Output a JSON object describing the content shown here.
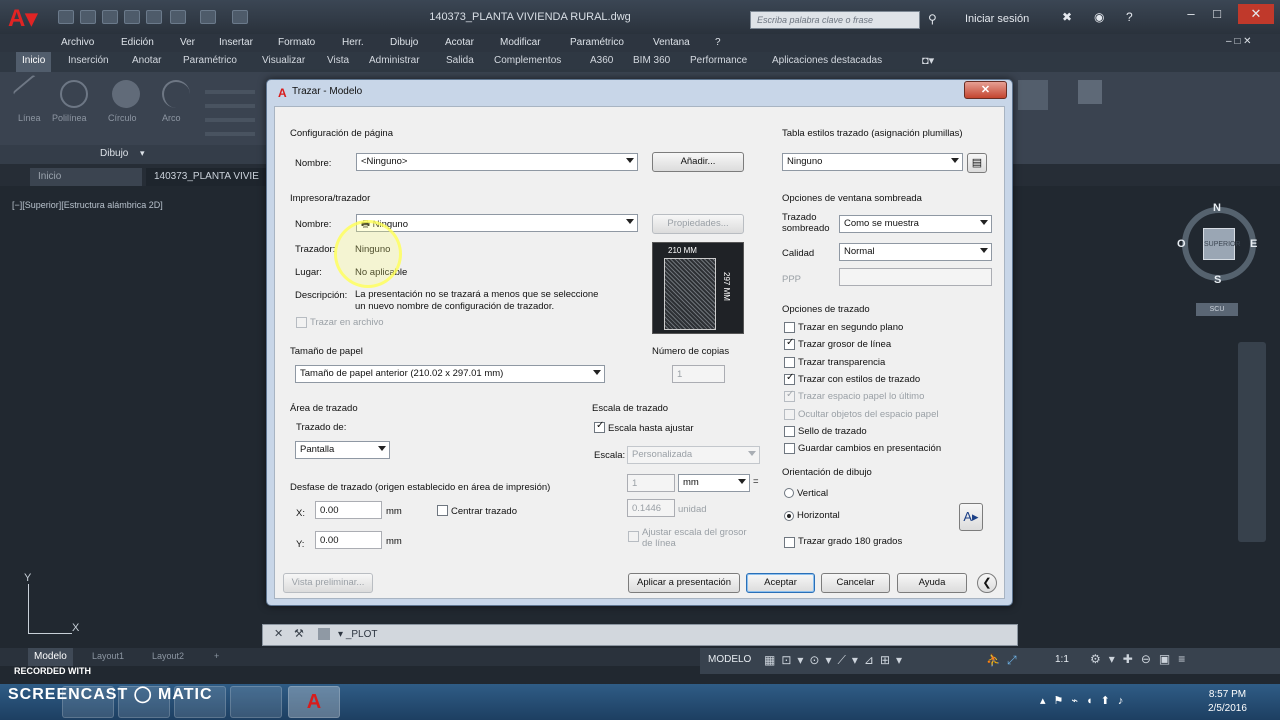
{
  "window": {
    "doc_title": "140373_PLANTA VIVIENDA RURAL.dwg",
    "search_placeholder": "Escriba palabra clave o frase",
    "login": "Iniciar sesión",
    "min": "–",
    "max": "□",
    "close": "✕"
  },
  "menu": [
    "Archivo",
    "Edición",
    "Ver",
    "Insertar",
    "Formato",
    "Herr.",
    "Dibujo",
    "Acotar",
    "Modificar",
    "Paramétrico",
    "Ventana",
    "?"
  ],
  "ribbon_tabs": [
    "Inicio",
    "Inserción",
    "Anotar",
    "Paramétrico",
    "Visualizar",
    "Vista",
    "Administrar",
    "Salida",
    "Complementos",
    "A360",
    "BIM 360",
    "Performance",
    "Aplicaciones destacadas"
  ],
  "ribbon_tools": [
    "Línea",
    "Polilínea",
    "Círculo",
    "Arco"
  ],
  "ribbon_panel": "Dibujo",
  "doc_tabs": [
    "Inicio",
    "140373_PLANTA VIVIE"
  ],
  "viewport_label": "[−][Superior][Estructura alámbrica 2D]",
  "viewcube": {
    "n": "N",
    "s": "S",
    "e": "E",
    "o": "O",
    "face": "SUPERIOR",
    "wcs": "SCU"
  },
  "ucs": {
    "x": "X",
    "y": "Y"
  },
  "command": "_PLOT",
  "layout_tabs": [
    "Modelo",
    "Layout1",
    "Layout2",
    "+"
  ],
  "status": {
    "mode": "MODELO",
    "scale": "1:1"
  },
  "watermark": {
    "line1": "RECORDED WITH",
    "line2": "SCREENCAST",
    "line3": "MATIC"
  },
  "clock": {
    "time": "8:57 PM",
    "date": "2/5/2016"
  },
  "dialog": {
    "title": "Trazar - Modelo",
    "close": "✕",
    "page_setup": {
      "heading": "Configuración de página",
      "name_label": "Nombre:",
      "name_value": "<Ninguno>",
      "add_button": "Añadir..."
    },
    "printer": {
      "heading": "Impresora/trazador",
      "name_label": "Nombre:",
      "name_value": "Ninguno",
      "properties_button": "Propiedades...",
      "plotter_label": "Trazador:",
      "plotter_value": "Ninguno",
      "where_label": "Lugar:",
      "where_value": "No aplicable",
      "desc_label": "Descripción:",
      "desc_value_1": "La presentación no se trazará a menos que se seleccione",
      "desc_value_2": "un nuevo nombre de configuración de trazador.",
      "plot_to_file": "Trazar en archivo",
      "preview_w": "210 MM",
      "preview_h": "297 MM"
    },
    "paper_size": {
      "heading": "Tamaño de papel",
      "value": "Tamaño de papel anterior (210.02 x 297.01 mm)"
    },
    "copies": {
      "heading": "Número de copias",
      "value": "1"
    },
    "plot_area": {
      "heading": "Área de trazado",
      "what_label": "Trazado de:",
      "what_value": "Pantalla"
    },
    "plot_offset": {
      "heading": "Desfase de trazado (origen establecido en área de impresión)",
      "x_label": "X:",
      "x_value": "0.00",
      "x_unit": "mm",
      "y_label": "Y:",
      "y_value": "0.00",
      "y_unit": "mm",
      "center": "Centrar trazado"
    },
    "plot_scale": {
      "heading": "Escala de trazado",
      "fit": "Escala hasta ajustar",
      "scale_label": "Escala:",
      "scale_value": "Personalizada",
      "v1": "1",
      "unit1": "mm",
      "eq": "=",
      "v2": "0.1446",
      "unit2": "unidad",
      "lineweights": "Ajustar escala del grosor de línea"
    },
    "style_table": {
      "heading": "Tabla estilos trazado (asignación plumillas)",
      "value": "Ninguno"
    },
    "shaded": {
      "heading": "Opciones de ventana sombreada",
      "shade_label": "Trazado sombreado",
      "shade_value": "Como se muestra",
      "quality_label": "Calidad",
      "quality_value": "Normal",
      "dpi_label": "PPP"
    },
    "plot_options": {
      "heading": "Opciones de trazado",
      "items": [
        {
          "label": "Trazar en segundo plano",
          "checked": false,
          "disabled": false
        },
        {
          "label": "Trazar grosor de línea",
          "checked": true,
          "disabled": false
        },
        {
          "label": "Trazar transparencia",
          "checked": false,
          "disabled": false
        },
        {
          "label": "Trazar con estilos de trazado",
          "checked": true,
          "disabled": false
        },
        {
          "label": "Trazar espacio papel lo último",
          "checked": true,
          "disabled": true
        },
        {
          "label": "Ocultar objetos del espacio papel",
          "checked": false,
          "disabled": true
        },
        {
          "label": "Sello de trazado",
          "checked": false,
          "disabled": false
        },
        {
          "label": "Guardar cambios en presentación",
          "checked": false,
          "disabled": false
        }
      ]
    },
    "orientation": {
      "heading": "Orientación de dibujo",
      "portrait": "Vertical",
      "landscape": "Horizontal",
      "upside": "Trazar grado 180 grados"
    },
    "buttons": {
      "preview": "Vista preliminar...",
      "apply": "Aplicar a presentación",
      "ok": "Aceptar",
      "cancel": "Cancelar",
      "help": "Ayuda"
    }
  }
}
